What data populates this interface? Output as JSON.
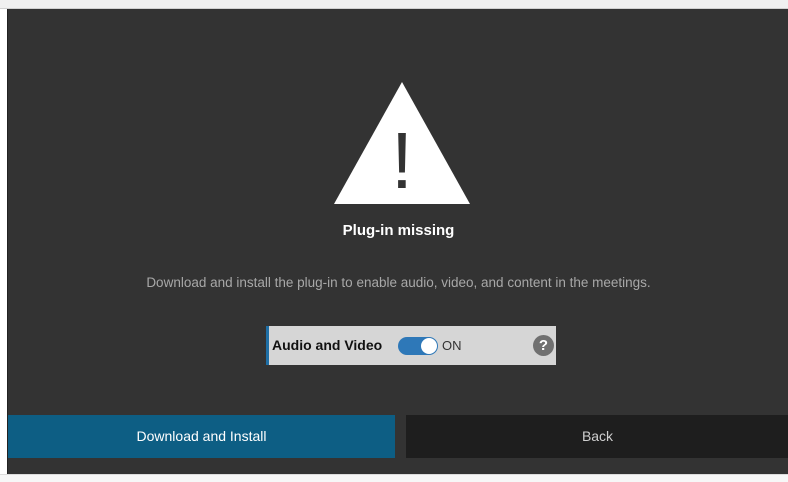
{
  "dialog": {
    "title": "Plug-in missing",
    "description": "Download and install the plug-in to enable audio, video, and content in the meetings.",
    "warning_mark": "!"
  },
  "toggle": {
    "label": "Audio and Video",
    "state": "ON",
    "help_mark": "?"
  },
  "buttons": {
    "download_label": "Download and Install",
    "back_label": "Back"
  },
  "colors": {
    "panel_bg": "#333333",
    "primary_button": "#0d5e84",
    "secondary_button": "#1e1e1e",
    "toggle_on": "#2e78b8"
  }
}
